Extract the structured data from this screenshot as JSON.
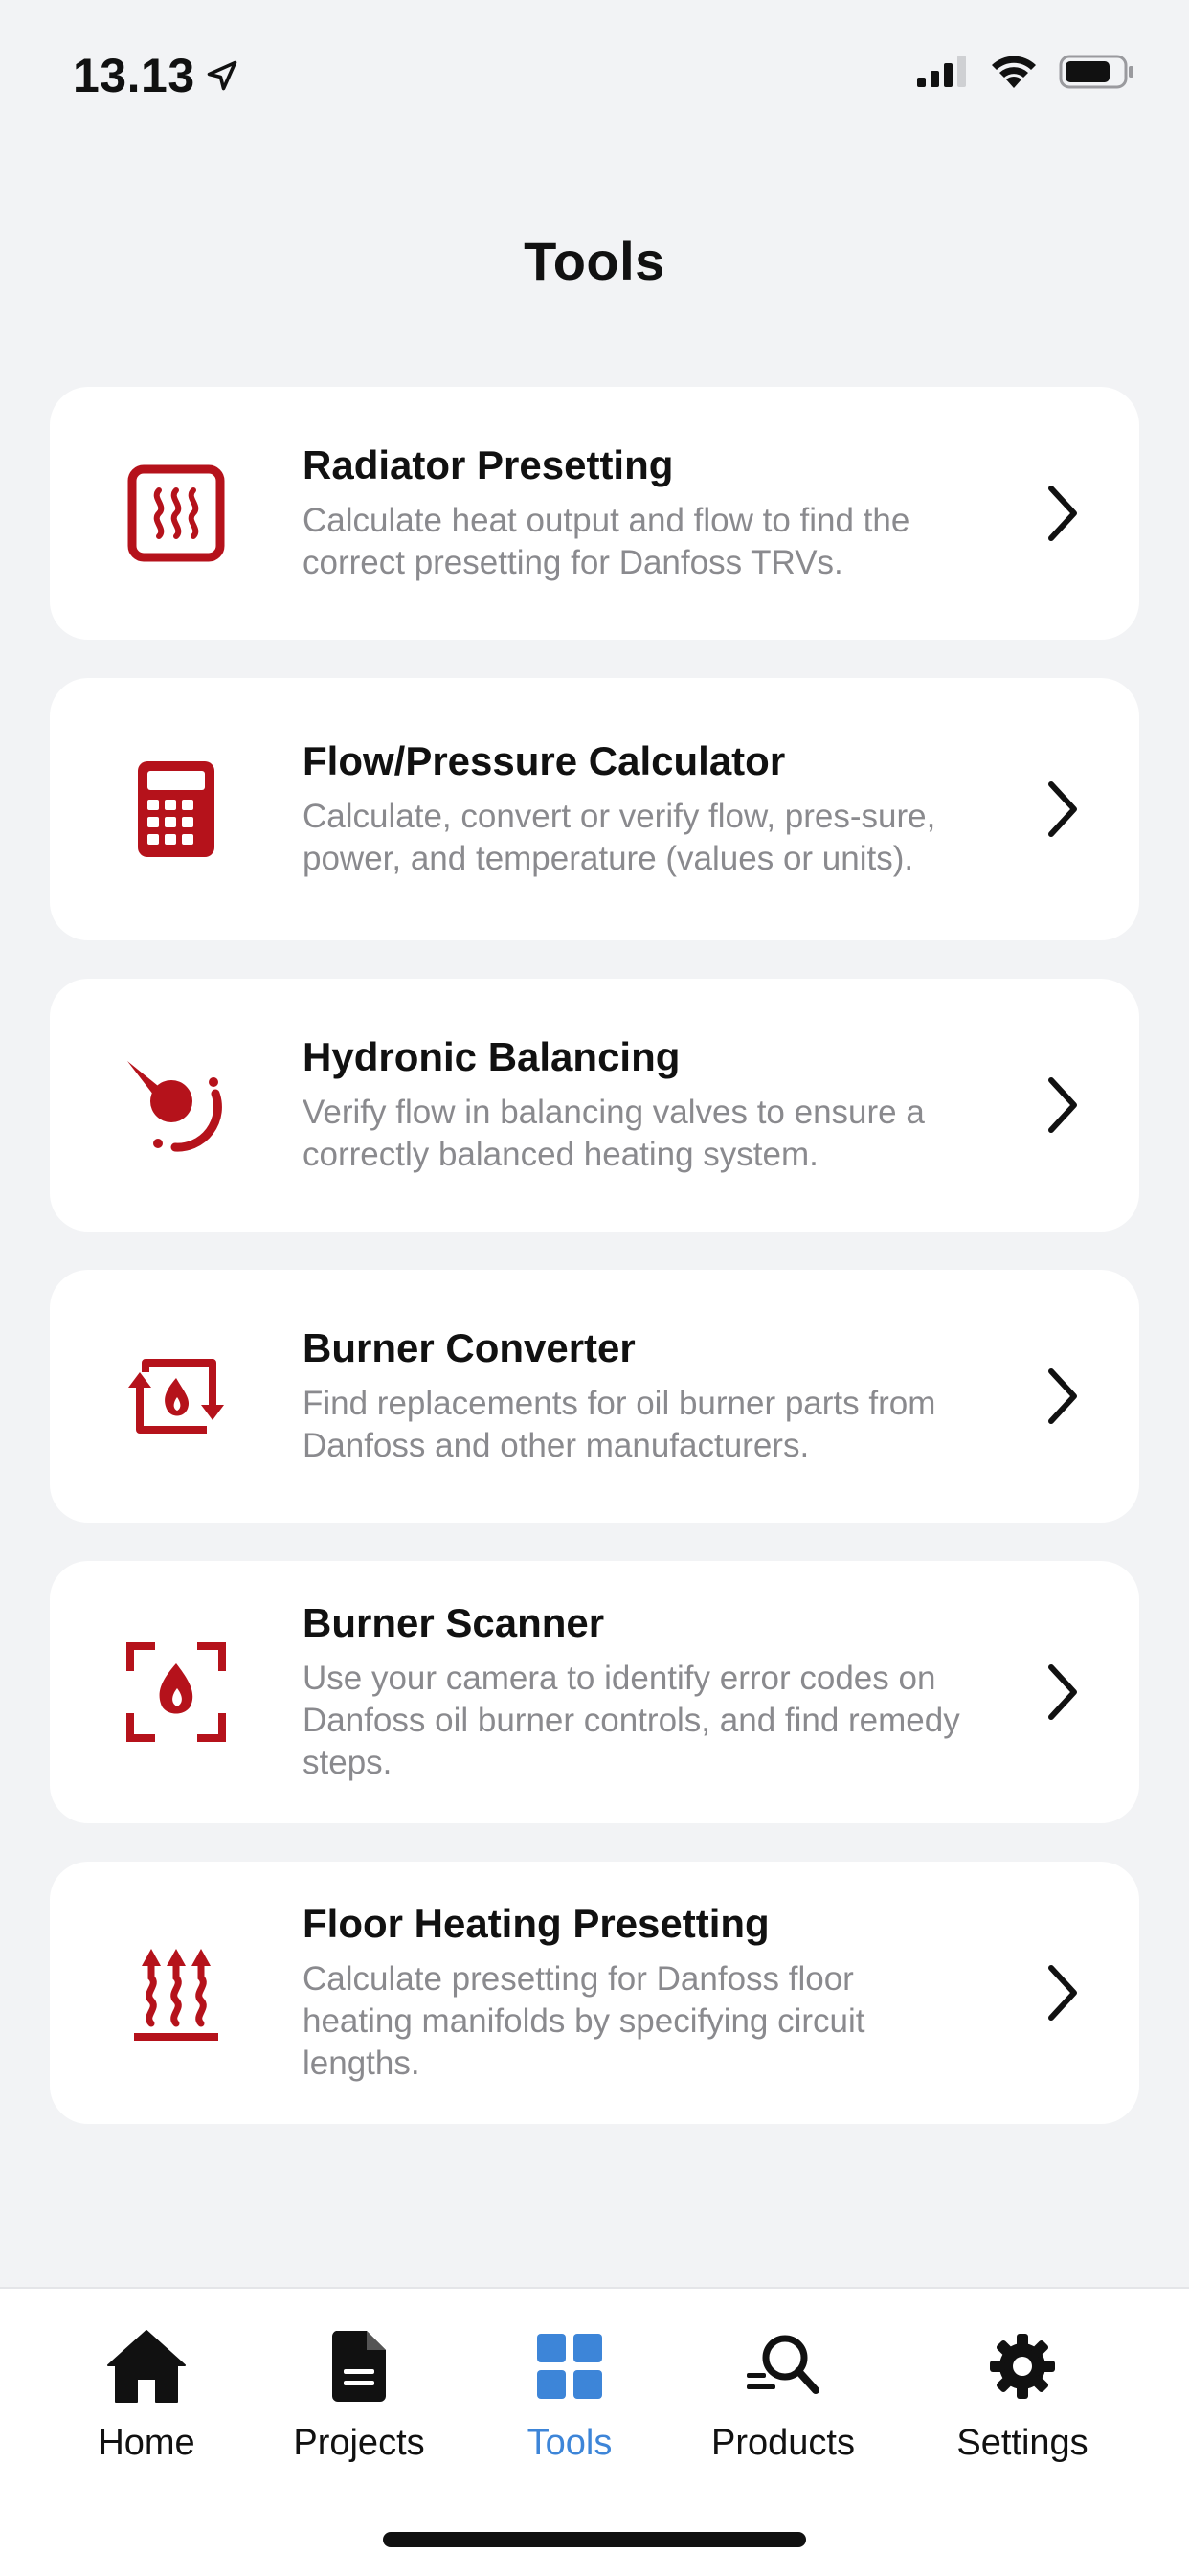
{
  "status_bar": {
    "time": "13.13"
  },
  "header": {
    "title": "Tools"
  },
  "tools": [
    {
      "title": "Radiator Presetting",
      "description": "Calculate heat output and flow to find the correct presetting for Danfoss TRVs.",
      "icon": "radiator-icon"
    },
    {
      "title": "Flow/Pressure Calculator",
      "description": "Calculate, convert or verify flow, pres-sure, power, and temperature (values or units).",
      "icon": "calculator-icon"
    },
    {
      "title": "Hydronic Balancing",
      "description": "Verify flow in balancing valves to ensure a correctly balanced heating system.",
      "icon": "balancing-gauge-icon"
    },
    {
      "title": "Burner Converter",
      "description": "Find replacements for oil burner parts from Danfoss and other manufacturers.",
      "icon": "burner-converter-icon"
    },
    {
      "title": "Burner Scanner",
      "description": "Use your camera to identify error codes on Danfoss oil burner controls, and find remedy steps.",
      "icon": "burner-scanner-icon"
    },
    {
      "title": "Floor Heating Presetting",
      "description": "Calculate presetting for Danfoss floor heating manifolds by specifying circuit lengths.",
      "icon": "floor-heating-icon"
    }
  ],
  "tab_bar": {
    "tabs": [
      {
        "label": "Home",
        "icon": "home-icon"
      },
      {
        "label": "Projects",
        "icon": "document-icon"
      },
      {
        "label": "Tools",
        "icon": "grid-icon",
        "active": true
      },
      {
        "label": "Products",
        "icon": "search-icon"
      },
      {
        "label": "Settings",
        "icon": "gear-icon"
      }
    ]
  },
  "colors": {
    "accent_red": "#b5121b",
    "active_blue": "#3d85d8",
    "background": "#f2f3f5",
    "card": "#ffffff",
    "muted_text": "#8a8a8e"
  }
}
